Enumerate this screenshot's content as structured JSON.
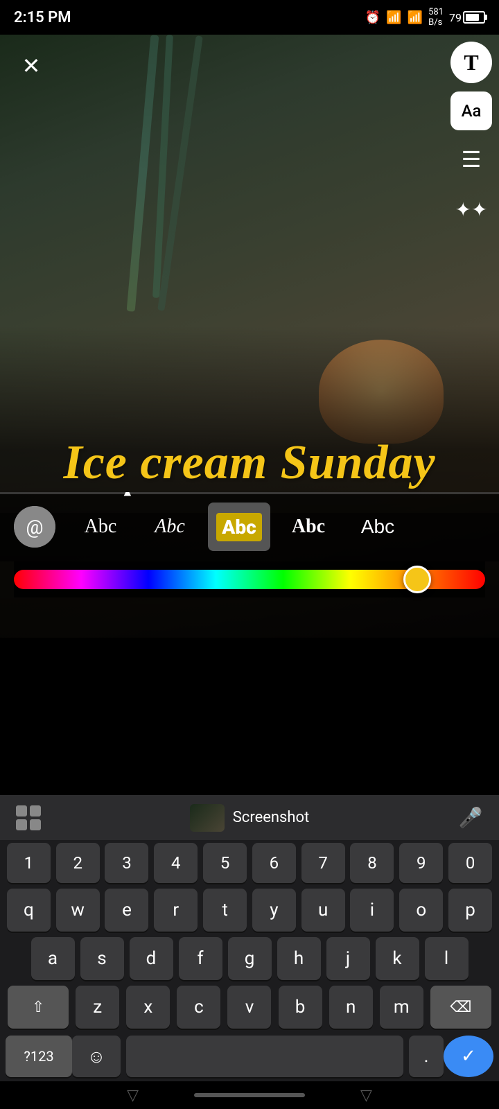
{
  "statusBar": {
    "time": "2:15 PM",
    "battery": "79"
  },
  "toolbar": {
    "textTool": "T",
    "fontTool": "Aa",
    "alignTool": "≡",
    "sparkleTool": "✦"
  },
  "photoText": {
    "content": "Ice cream Sunday"
  },
  "fontStyles": [
    {
      "id": "emoji",
      "label": "@",
      "type": "emoji"
    },
    {
      "id": "serif",
      "label": "Abc",
      "type": "serif"
    },
    {
      "id": "script",
      "label": "Abc",
      "type": "script"
    },
    {
      "id": "bold-bg",
      "label": "Abc",
      "type": "bold-bg",
      "active": true
    },
    {
      "id": "sans",
      "label": "Abc",
      "type": "sans"
    },
    {
      "id": "light",
      "label": "Abc",
      "type": "light"
    }
  ],
  "keyboard": {
    "suggestionText": "Screenshot",
    "rows": {
      "numbers": [
        "1",
        "2",
        "3",
        "4",
        "5",
        "6",
        "7",
        "8",
        "9",
        "0"
      ],
      "row1": [
        "q",
        "w",
        "e",
        "r",
        "t",
        "y",
        "u",
        "i",
        "o",
        "p"
      ],
      "row2": [
        "a",
        "s",
        "d",
        "f",
        "g",
        "h",
        "j",
        "k",
        "l"
      ],
      "row3": [
        "z",
        "x",
        "c",
        "v",
        "b",
        "n",
        "m"
      ],
      "bottom": {
        "num123": "?123",
        "emoji": "☺",
        "space": "",
        "period": ".",
        "enter": "✓"
      }
    }
  },
  "homeBar": {
    "triangle": "▽"
  }
}
